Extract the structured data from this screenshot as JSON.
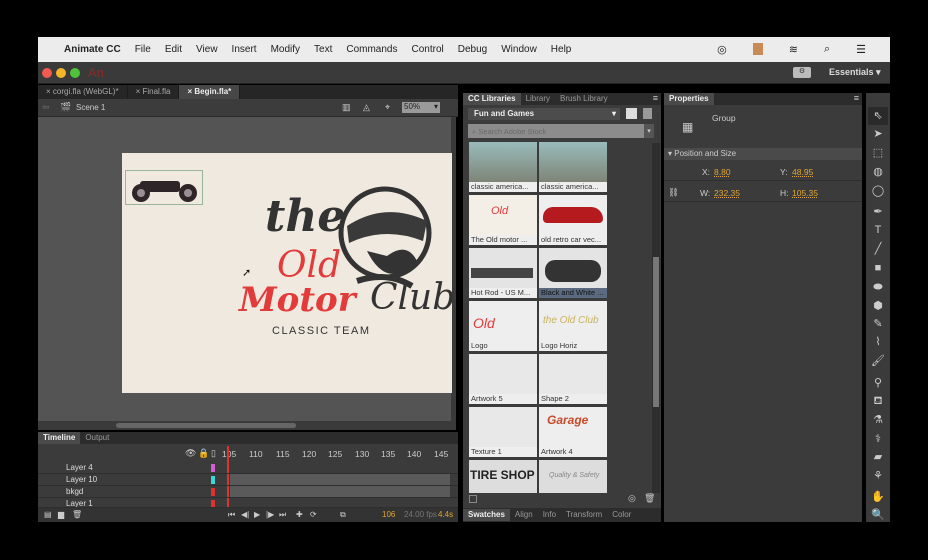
{
  "menubar": {
    "app": "Animate CC",
    "items": [
      "File",
      "Edit",
      "View",
      "Insert",
      "Modify",
      "Text",
      "Commands",
      "Control",
      "Debug",
      "Window",
      "Help"
    ]
  },
  "titlebar": {
    "logo": "An",
    "workspace": "Essentials"
  },
  "doc_tabs": [
    "corgi.fla (WebGL)*",
    "Final.fla",
    "Begin.fla*"
  ],
  "editbar": {
    "scene": "Scene 1",
    "zoom": "50%"
  },
  "stage": {
    "logo_line1": "the",
    "logo_line2": "Old",
    "logo_line3": "Motor",
    "logo_line4": "Club",
    "tagline": "CLASSIC TEAM"
  },
  "timeline": {
    "tabs": [
      "Timeline",
      "Output"
    ],
    "ruler": [
      "105",
      "110",
      "115",
      "120",
      "125",
      "130",
      "135",
      "140",
      "145"
    ],
    "layers": [
      {
        "name": "Layer 4",
        "color": "#d45fd4"
      },
      {
        "name": "Layer 10",
        "color": "#3fd6d6"
      },
      {
        "name": "bkgd",
        "color": "#e03030"
      },
      {
        "name": "Layer 1",
        "color": "#e03030"
      }
    ],
    "frame": "106",
    "fps": "24.00 fps",
    "time": "4.4s"
  },
  "library": {
    "tabs": [
      "CC Libraries",
      "Library",
      "Brush Library"
    ],
    "selected_library": "Fun and Games",
    "search_placeholder": "Search Adobe Stock",
    "items": [
      "classic america...",
      "classic america...",
      "The Old motor ...",
      "old retro car vec...",
      "Hot Rod - US M...",
      "Black and White ...",
      "Logo",
      "Logo Horiz",
      "Artwork 5",
      "Shape 2",
      "Texture 1",
      "Artwork 4",
      "TIRE SHOP",
      "Quality & Safety"
    ],
    "bottom_tabs": [
      "Swatches",
      "Align",
      "Info",
      "Transform",
      "Color"
    ]
  },
  "properties": {
    "tab": "Properties",
    "type": "Group",
    "section": "Position and Size",
    "x_label": "X:",
    "x": "8.80",
    "y_label": "Y:",
    "y": "48.95",
    "w_label": "W:",
    "w": "232.35",
    "h_label": "H:",
    "h": "105.35"
  }
}
